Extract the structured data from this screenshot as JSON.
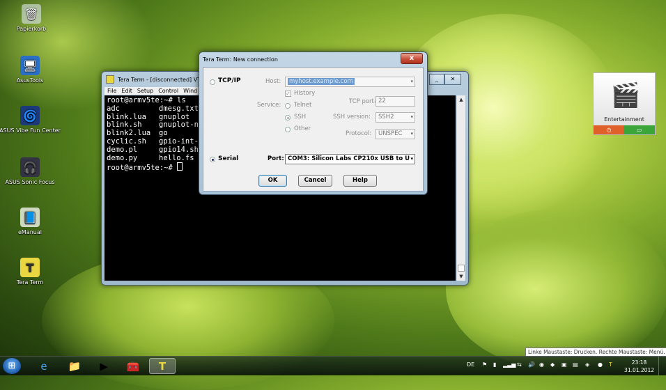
{
  "desktop": {
    "icons": [
      {
        "label": "Papierkorb",
        "glyph": "🗑"
      },
      {
        "label": "AsusTools",
        "glyph": "🖥"
      },
      {
        "label": "ASUS Vibe Fun Center",
        "glyph": "🌀"
      },
      {
        "label": "ASUS Sonic Focus",
        "glyph": "🎧"
      },
      {
        "label": "eManual",
        "glyph": "📘"
      },
      {
        "label": "Tera Term",
        "glyph": "T"
      }
    ]
  },
  "terminal": {
    "title": "Tera Term - [disconnected] VT",
    "menu": [
      "File",
      "Edit",
      "Setup",
      "Control",
      "Wind"
    ],
    "prompt_cmd": "root@armv5te:~# ls",
    "files": [
      [
        "adc",
        "dmesg.txt"
      ],
      [
        "blink.lua",
        "gnuplot"
      ],
      [
        "blink.sh",
        "gnuplot-no"
      ],
      [
        "blink2.lua",
        "go"
      ],
      [
        "cyclic.sh",
        "gpio-int-t"
      ],
      [
        "demo.pl",
        "gpio14.sh"
      ],
      [
        "demo.py",
        "hello.fs"
      ]
    ],
    "prompt_end": "root@armv5te:~# "
  },
  "dialog": {
    "title": "Tera Term: New connection",
    "close_label": "x",
    "tcpip_label": "TCP/IP",
    "host_label": "Host:",
    "host_value": "myhost.example.com",
    "history_label": "History",
    "service_label": "Service:",
    "telnet_label": "Telnet",
    "ssh_label": "SSH",
    "other_label": "Other",
    "tcp_port_label": "TCP port#:",
    "tcp_port_value": "22",
    "ssh_version_label": "SSH version:",
    "ssh_version_value": "SSH2",
    "protocol_label": "Protocol:",
    "protocol_value": "UNSPEC",
    "serial_label": "Serial",
    "port_label": "Port:",
    "port_value": "COM3: Silicon Labs CP210x USB to U",
    "ok_label": "OK",
    "cancel_label": "Cancel",
    "help_label": "Help"
  },
  "gadget": {
    "label": "Entertainment"
  },
  "tooltip": "Linke Maustaste: Drucken. Rechte Maustaste: Menü.",
  "taskbar": {
    "language": "DE",
    "time": "23:18",
    "date": "31.01.2012"
  }
}
